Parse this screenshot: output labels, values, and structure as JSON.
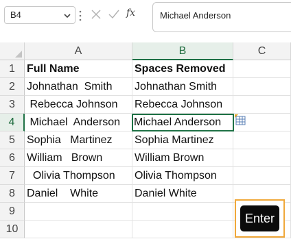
{
  "formula_bar": {
    "name_box": "B4",
    "cancel_icon": "x-icon",
    "confirm_icon": "check-icon",
    "fx_label": "fx",
    "formula": "Michael Anderson"
  },
  "grid": {
    "columns": [
      "A",
      "B",
      "C"
    ],
    "active_column": "B",
    "rows": [
      "1",
      "2",
      "3",
      "4",
      "5",
      "6",
      "7",
      "8",
      "9",
      "10"
    ],
    "active_row": "4",
    "cells": {
      "A": [
        "Full Name",
        "Johnathan  Smith",
        " Rebecca Johnson",
        " Michael  Anderson",
        "Sophia   Martinez",
        "William   Brown",
        "  Olivia Thompson",
        "Daniel    White",
        "",
        ""
      ],
      "B": [
        "Spaces Removed",
        "Johnathan Smith",
        "Rebecca Johnson",
        "Michael Anderson",
        "Sophia Martinez",
        "William Brown",
        "Olivia Thompson",
        "Daniel White",
        "",
        ""
      ],
      "C": [
        "",
        "",
        "",
        "",
        "",
        "",
        "",
        "",
        "",
        ""
      ]
    },
    "quick_analysis_icon": "quick-analysis-icon"
  },
  "key_hint": {
    "label": "Enter"
  },
  "colors": {
    "accent_green": "#1e7145",
    "highlight_orange": "#f0a83a"
  }
}
